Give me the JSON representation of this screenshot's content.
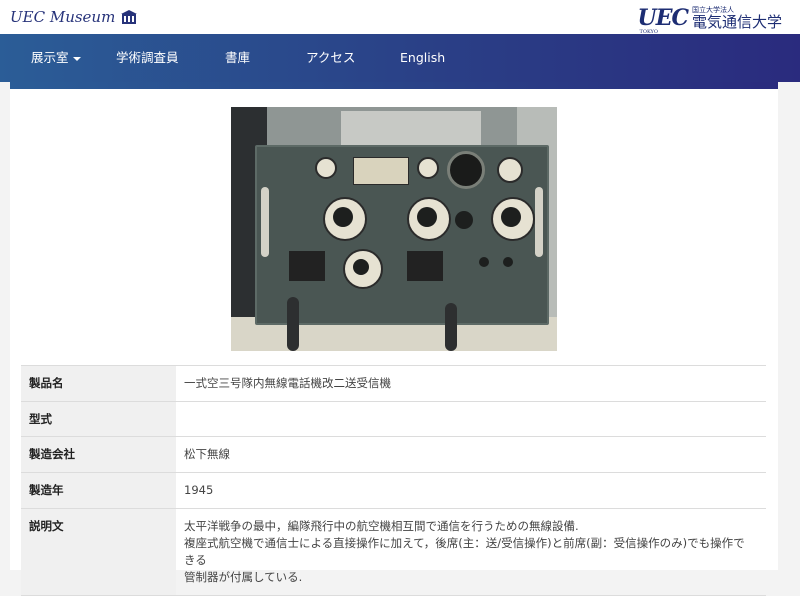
{
  "brand": {
    "site_title": "UEC Museum",
    "museum_icon": "museum-building-icon"
  },
  "university_logo": {
    "mark": "UEC",
    "mark_sub": "TOKYO",
    "subtitle": "国立大学法人",
    "name": "電気通信大学"
  },
  "nav": {
    "items": [
      {
        "label": "展示室",
        "has_dropdown": true
      },
      {
        "label": "学術調査員"
      },
      {
        "label": "書庫"
      },
      {
        "label": "アクセス"
      },
      {
        "label": "English"
      }
    ]
  },
  "photo": {
    "subject": "radio-receiver-photo"
  },
  "spec_table": {
    "rows": [
      {
        "label": "製品名",
        "value": "一式空三号隊内無線電話機改二送受信機"
      },
      {
        "label": "型式",
        "value": ""
      },
      {
        "label": "製造会社",
        "value": "松下無線"
      },
      {
        "label": "製造年",
        "value": "1945"
      },
      {
        "label": "説明文",
        "lines": [
          "太平洋戦争の最中，編隊飛行中の航空機相互間で通信を行うための無線設備.",
          "複座式航空機で通信士による直接操作に加えて，後席(主：送/受信操作)と前席(副：受信操作のみ)でも操作できる",
          "管制器が付属している."
        ]
      }
    ]
  },
  "colors": {
    "nav_start": "#2b5d97",
    "nav_end": "#2a2b7e",
    "brand_text": "#27337a"
  }
}
